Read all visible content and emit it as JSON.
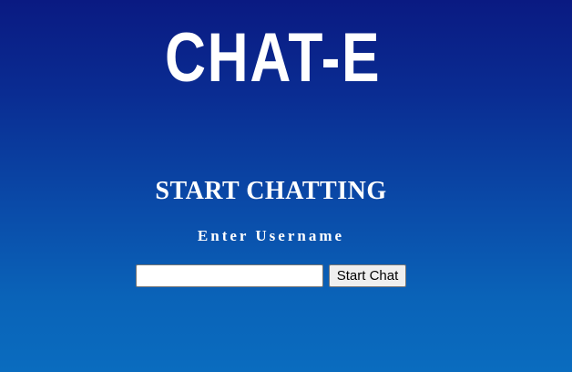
{
  "brand": {
    "logo_text": "CHAT-E"
  },
  "main": {
    "headline": "START CHATTING",
    "subheadline": "Enter Username"
  },
  "form": {
    "username_value": "",
    "start_button_label": "Start Chat"
  },
  "colors": {
    "background_top": "#0a1a82",
    "background_bottom": "#0a6cbf",
    "text": "#ffffff"
  }
}
